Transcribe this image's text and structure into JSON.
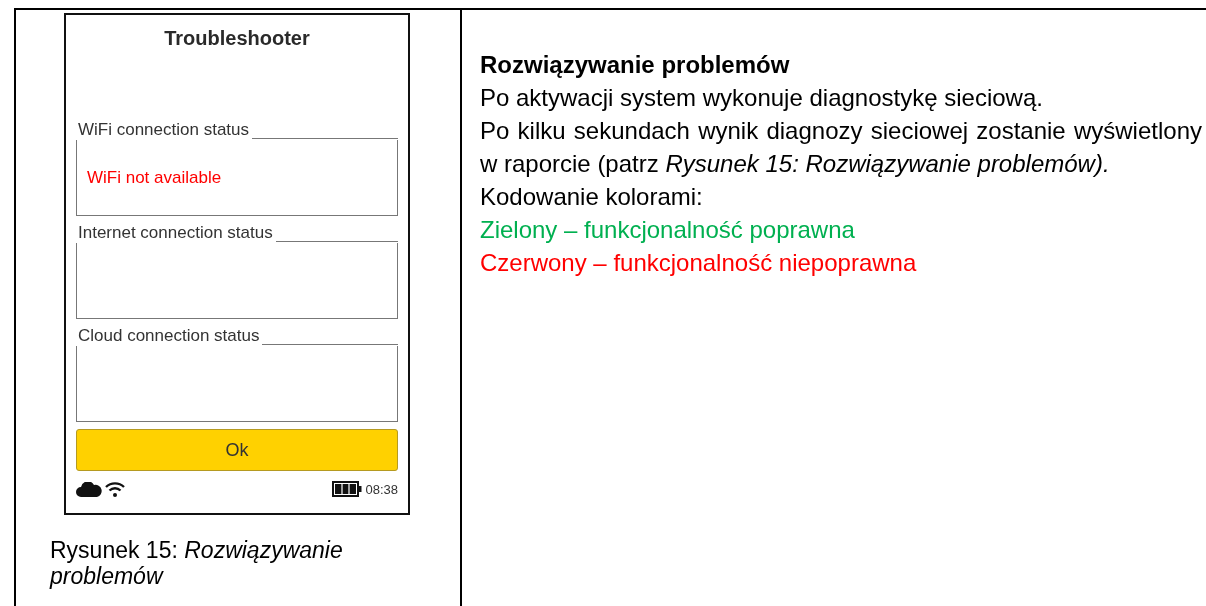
{
  "device_screen": {
    "title": "Troubleshooter",
    "status_groups": [
      {
        "label": "WiFi connection status",
        "value": "WiFi not available",
        "color": "#ff0000"
      },
      {
        "label": "Internet connection status"
      },
      {
        "label": "Cloud connection status"
      }
    ],
    "ok_button": "Ok",
    "status_bar": {
      "cloud_connected": true,
      "wifi_connected": true,
      "battery": {
        "level": 1
      },
      "time": "08:38"
    }
  },
  "caption": "Rysunek 15: *Rozwiązywanie problemów*",
  "section": {
    "heading": "Rozwiązywanie problemów",
    "paragraphs": [
      "Po aktywacji system wykonuje diagnostykę sieciową.",
      "Po kilku sekundach wynik diagnozy sieciowej zostanie wyświetlony w raporcie (patrz *Rysunek 15: Rozwiązywanie problemów).*",
      "Kodowanie kolorami:"
    ],
    "legend": [
      {
        "text": "Zielony – funkcjonalność poprawna",
        "color": "#00b050"
      },
      {
        "text": "Czerwony – funkcjonalność niepoprawna",
        "color": "#ff0000"
      }
    ]
  }
}
